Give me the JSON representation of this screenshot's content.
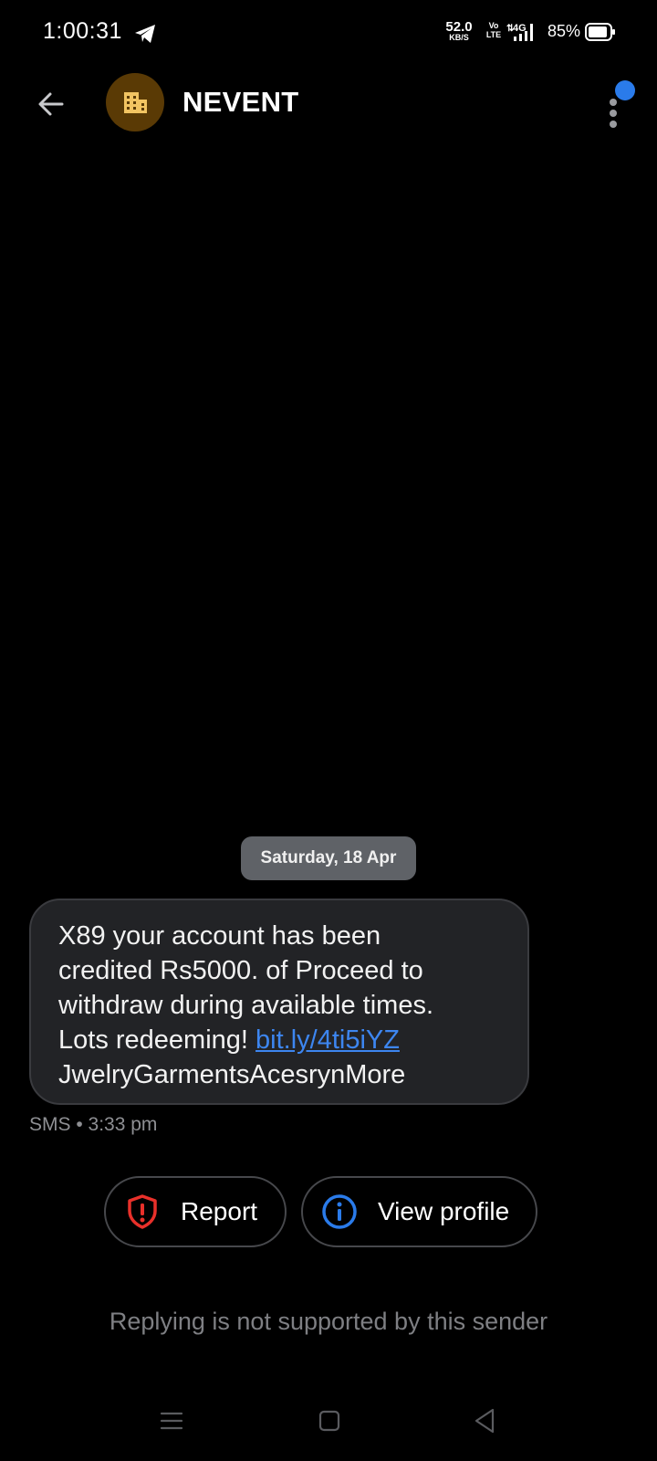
{
  "status_bar": {
    "time": "1:00:31",
    "net_speed_value": "52.0",
    "net_speed_unit": "KB/S",
    "volte_top": "Vo",
    "volte_bottom": "LTE",
    "network_type": "4G",
    "battery_percent": "85%"
  },
  "header": {
    "contact_name": "NEVENT",
    "avatar_icon": "building-icon",
    "accent_color": "#2a7bea"
  },
  "conversation": {
    "date_chip": "Saturday, 18 Apr",
    "message": {
      "text_before_link": "X89 your account has been\ncredited Rs5000. of Proceed to\nwithdraw during available times.\nLots redeeming! ",
      "link_text": "bit.ly/4ti5iYZ",
      "text_after_link": "\nJwelryGarmentsAcesrynMore",
      "meta": "SMS • 3:33 pm"
    }
  },
  "actions": {
    "report_label": "Report",
    "report_icon": "shield-alert-icon",
    "report_color": "#e8302a",
    "view_profile_label": "View profile",
    "view_profile_icon": "info-icon",
    "view_profile_color": "#2a7bea"
  },
  "footer": {
    "reply_note": "Replying is not supported by this sender"
  }
}
